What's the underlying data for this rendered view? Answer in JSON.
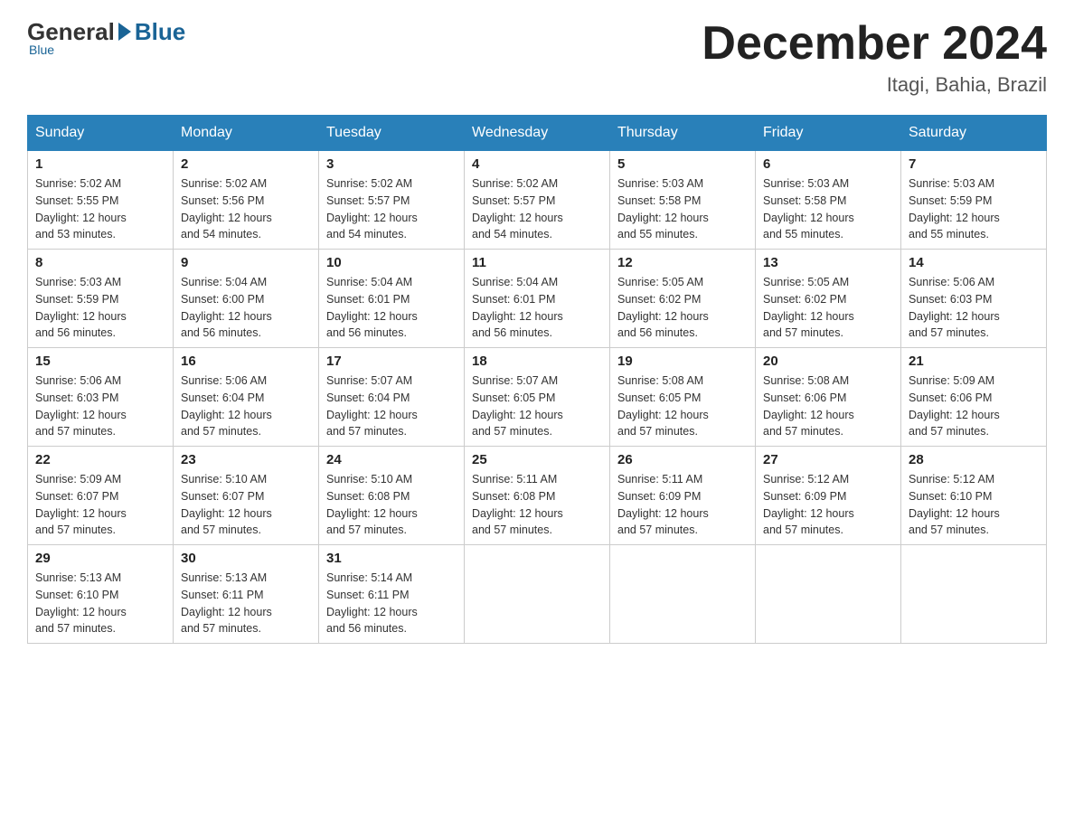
{
  "logo": {
    "general": "General",
    "blue": "Blue",
    "sub": "Blue"
  },
  "title": "December 2024",
  "subtitle": "Itagi, Bahia, Brazil",
  "days_of_week": [
    "Sunday",
    "Monday",
    "Tuesday",
    "Wednesday",
    "Thursday",
    "Friday",
    "Saturday"
  ],
  "weeks": [
    [
      {
        "num": "1",
        "sunrise": "5:02 AM",
        "sunset": "5:55 PM",
        "daylight": "12 hours and 53 minutes."
      },
      {
        "num": "2",
        "sunrise": "5:02 AM",
        "sunset": "5:56 PM",
        "daylight": "12 hours and 54 minutes."
      },
      {
        "num": "3",
        "sunrise": "5:02 AM",
        "sunset": "5:57 PM",
        "daylight": "12 hours and 54 minutes."
      },
      {
        "num": "4",
        "sunrise": "5:02 AM",
        "sunset": "5:57 PM",
        "daylight": "12 hours and 54 minutes."
      },
      {
        "num": "5",
        "sunrise": "5:03 AM",
        "sunset": "5:58 PM",
        "daylight": "12 hours and 55 minutes."
      },
      {
        "num": "6",
        "sunrise": "5:03 AM",
        "sunset": "5:58 PM",
        "daylight": "12 hours and 55 minutes."
      },
      {
        "num": "7",
        "sunrise": "5:03 AM",
        "sunset": "5:59 PM",
        "daylight": "12 hours and 55 minutes."
      }
    ],
    [
      {
        "num": "8",
        "sunrise": "5:03 AM",
        "sunset": "5:59 PM",
        "daylight": "12 hours and 56 minutes."
      },
      {
        "num": "9",
        "sunrise": "5:04 AM",
        "sunset": "6:00 PM",
        "daylight": "12 hours and 56 minutes."
      },
      {
        "num": "10",
        "sunrise": "5:04 AM",
        "sunset": "6:01 PM",
        "daylight": "12 hours and 56 minutes."
      },
      {
        "num": "11",
        "sunrise": "5:04 AM",
        "sunset": "6:01 PM",
        "daylight": "12 hours and 56 minutes."
      },
      {
        "num": "12",
        "sunrise": "5:05 AM",
        "sunset": "6:02 PM",
        "daylight": "12 hours and 56 minutes."
      },
      {
        "num": "13",
        "sunrise": "5:05 AM",
        "sunset": "6:02 PM",
        "daylight": "12 hours and 57 minutes."
      },
      {
        "num": "14",
        "sunrise": "5:06 AM",
        "sunset": "6:03 PM",
        "daylight": "12 hours and 57 minutes."
      }
    ],
    [
      {
        "num": "15",
        "sunrise": "5:06 AM",
        "sunset": "6:03 PM",
        "daylight": "12 hours and 57 minutes."
      },
      {
        "num": "16",
        "sunrise": "5:06 AM",
        "sunset": "6:04 PM",
        "daylight": "12 hours and 57 minutes."
      },
      {
        "num": "17",
        "sunrise": "5:07 AM",
        "sunset": "6:04 PM",
        "daylight": "12 hours and 57 minutes."
      },
      {
        "num": "18",
        "sunrise": "5:07 AM",
        "sunset": "6:05 PM",
        "daylight": "12 hours and 57 minutes."
      },
      {
        "num": "19",
        "sunrise": "5:08 AM",
        "sunset": "6:05 PM",
        "daylight": "12 hours and 57 minutes."
      },
      {
        "num": "20",
        "sunrise": "5:08 AM",
        "sunset": "6:06 PM",
        "daylight": "12 hours and 57 minutes."
      },
      {
        "num": "21",
        "sunrise": "5:09 AM",
        "sunset": "6:06 PM",
        "daylight": "12 hours and 57 minutes."
      }
    ],
    [
      {
        "num": "22",
        "sunrise": "5:09 AM",
        "sunset": "6:07 PM",
        "daylight": "12 hours and 57 minutes."
      },
      {
        "num": "23",
        "sunrise": "5:10 AM",
        "sunset": "6:07 PM",
        "daylight": "12 hours and 57 minutes."
      },
      {
        "num": "24",
        "sunrise": "5:10 AM",
        "sunset": "6:08 PM",
        "daylight": "12 hours and 57 minutes."
      },
      {
        "num": "25",
        "sunrise": "5:11 AM",
        "sunset": "6:08 PM",
        "daylight": "12 hours and 57 minutes."
      },
      {
        "num": "26",
        "sunrise": "5:11 AM",
        "sunset": "6:09 PM",
        "daylight": "12 hours and 57 minutes."
      },
      {
        "num": "27",
        "sunrise": "5:12 AM",
        "sunset": "6:09 PM",
        "daylight": "12 hours and 57 minutes."
      },
      {
        "num": "28",
        "sunrise": "5:12 AM",
        "sunset": "6:10 PM",
        "daylight": "12 hours and 57 minutes."
      }
    ],
    [
      {
        "num": "29",
        "sunrise": "5:13 AM",
        "sunset": "6:10 PM",
        "daylight": "12 hours and 57 minutes."
      },
      {
        "num": "30",
        "sunrise": "5:13 AM",
        "sunset": "6:11 PM",
        "daylight": "12 hours and 57 minutes."
      },
      {
        "num": "31",
        "sunrise": "5:14 AM",
        "sunset": "6:11 PM",
        "daylight": "12 hours and 56 minutes."
      },
      null,
      null,
      null,
      null
    ]
  ],
  "labels": {
    "sunrise": "Sunrise:",
    "sunset": "Sunset:",
    "daylight": "Daylight:"
  }
}
